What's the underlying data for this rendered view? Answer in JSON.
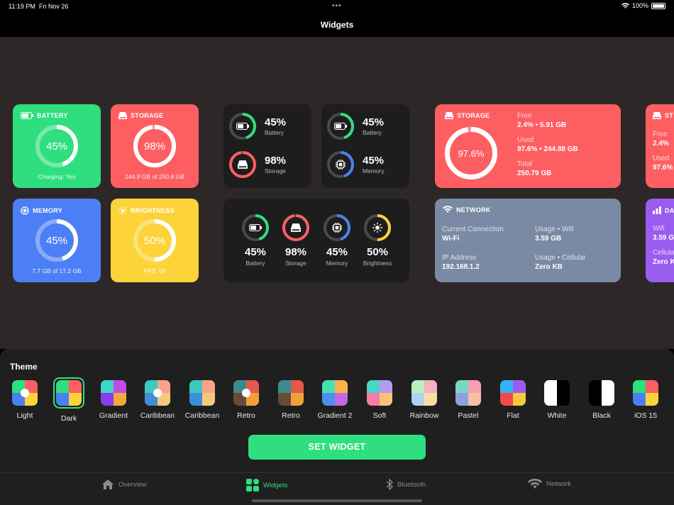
{
  "status": {
    "time": "11:19 PM",
    "date": "Fri Nov 26",
    "battery": "100%"
  },
  "nav": {
    "title": "Widgets"
  },
  "colors": {
    "green": "#2fdf7f",
    "red": "#fd5e62",
    "blue": "#4c7ff5",
    "yellow": "#fdd33a",
    "slate": "#7a8aa4",
    "purple": "#9b5cf0"
  },
  "widgets": {
    "battery": {
      "title": "BATTERY",
      "value": "45%",
      "percent": 45,
      "foot": "Charging: Yes"
    },
    "storage": {
      "title": "STORAGE",
      "value": "98%",
      "percent": 98,
      "foot": "244.9 GB of 250.8 GB"
    },
    "memory": {
      "title": "MEMORY",
      "value": "45%",
      "percent": 45,
      "foot": "7.7 GB of 17.2 GB"
    },
    "brightness": {
      "title": "BRIGHTNESS",
      "value": "50%",
      "percent": 50,
      "foot": "FPS: 60"
    },
    "dual1": [
      {
        "value": "45%",
        "label": "Battery"
      },
      {
        "value": "98%",
        "label": "Storage"
      }
    ],
    "dual2": [
      {
        "value": "45%",
        "label": "Battery"
      },
      {
        "value": "45%",
        "label": "Memory"
      }
    ],
    "quad": [
      {
        "value": "45%",
        "label": "Battery"
      },
      {
        "value": "98%",
        "label": "Storage"
      },
      {
        "value": "45%",
        "label": "Memory"
      },
      {
        "value": "50%",
        "label": "Brightness"
      }
    ],
    "storage_large": {
      "title": "STORAGE",
      "value": "97.6%",
      "percent": 97.6,
      "free_label": "Free",
      "free": "2.4% • 5.91 GB",
      "used_label": "Used",
      "used": "97.6% • 244.88 GB",
      "total_label": "Total",
      "total": "250.79 GB"
    },
    "network": {
      "title": "NETWORK",
      "conn_label": "Current Connection",
      "conn": "Wi-Fi",
      "usage_wifi_label": "Usage • Wifi",
      "usage_wifi": "3.59 GB",
      "ip_label": "IP Address",
      "ip": "192.168.1.2",
      "usage_cell_label": "Usage • Cellular",
      "usage_cell": "Zero KB"
    },
    "partial_storage": {
      "title": "ST",
      "free_label": "Free",
      "free": "2.4%",
      "used_label": "Used",
      "used": "97.6%"
    },
    "partial_data": {
      "title": "DA",
      "wifi_label": "Wifi",
      "wifi": "3.59 G",
      "cell_label": "Cellula",
      "cell": "Zero K"
    }
  },
  "panel": {
    "title": "Theme"
  },
  "themes": [
    {
      "name": "Light",
      "c": [
        "#2fdf7f",
        "#fd5e62",
        "#4c7ff5",
        "#fdd33a"
      ],
      "dot": true
    },
    {
      "name": "Dark",
      "c": [
        "#2fdf7f",
        "#fd5e62",
        "#4c7ff5",
        "#fdd33a"
      ],
      "dot": false,
      "selected": true
    },
    {
      "name": "Gradient",
      "c": [
        "#3fd6c9",
        "#c04de8",
        "#8b3be8",
        "#f0a93a"
      ],
      "dot": false
    },
    {
      "name": "Caribbean",
      "c": [
        "#3ec8c0",
        "#f7a38c",
        "#3e8fd6",
        "#f6c97a"
      ],
      "dot": true
    },
    {
      "name": "Caribbean",
      "c": [
        "#3ec8c0",
        "#f7a38c",
        "#3e8fd6",
        "#f6c97a"
      ],
      "dot": false
    },
    {
      "name": "Retro",
      "c": [
        "#3a8c8c",
        "#e35a4a",
        "#6a4a3a",
        "#f0a13a"
      ],
      "dot": true
    },
    {
      "name": "Retro",
      "c": [
        "#3a8c8c",
        "#e35a4a",
        "#6a4a3a",
        "#f0a13a"
      ],
      "dot": false
    },
    {
      "name": "Gradient 2",
      "c": [
        "#48e0b0",
        "#f7b24a",
        "#4a8ff0",
        "#c06ae0"
      ],
      "dot": false
    },
    {
      "name": "Soft",
      "c": [
        "#48d6c8",
        "#b59af0",
        "#f77aa8",
        "#f7c27a"
      ],
      "dot": false
    },
    {
      "name": "Rainbow",
      "c": [
        "#b8f0c0",
        "#f7b0c0",
        "#b0d0f7",
        "#f7e0a0"
      ],
      "dot": false
    },
    {
      "name": "Pastel",
      "c": [
        "#7ad6c8",
        "#f7a0b0",
        "#8fa0e0",
        "#f7c0a0"
      ],
      "dot": false
    },
    {
      "name": "Flat",
      "c": [
        "#3ab0f0",
        "#9a5cf0",
        "#f04a4a",
        "#f7c83a"
      ],
      "dot": false
    },
    {
      "name": "White",
      "c": [
        "#ffffff",
        "#000000",
        "#ffffff",
        "#000000"
      ],
      "dot": false
    },
    {
      "name": "Black",
      "c": [
        "#000000",
        "#ffffff",
        "#000000",
        "#ffffff"
      ],
      "dot": false
    },
    {
      "name": "iOS 15",
      "c": [
        "#2fdf7f",
        "#fd5e62",
        "#4c7ff5",
        "#fdd33a"
      ],
      "dot": false
    }
  ],
  "button": {
    "set_widget": "SET WIDGET"
  },
  "tabs": [
    {
      "label": "Overview"
    },
    {
      "label": "Widgets"
    },
    {
      "label": "Bluetooth"
    },
    {
      "label": "Network"
    }
  ]
}
